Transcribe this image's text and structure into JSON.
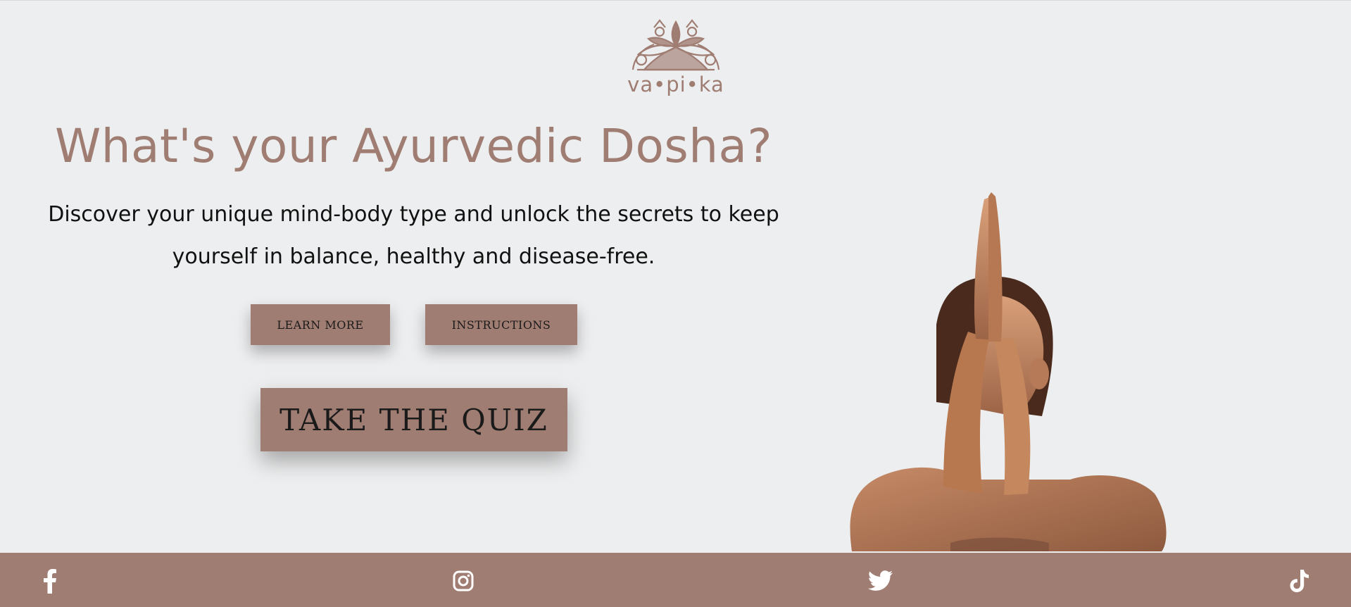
{
  "brand": {
    "name": "va•pi•ka",
    "logo_icon": "mandala-lotus-icon",
    "color": "#a07d72"
  },
  "hero": {
    "title": "What's your Ayurvedic Dosha?",
    "subtitle": "Discover your unique mind-body type and unlock the secrets to keep yourself in balance, healthy and disease-free.",
    "image": "woman-prayer-hands-photo"
  },
  "buttons": {
    "learn_more": "LEARN MORE",
    "instructions": "INSTRUCTIONS",
    "take_quiz": "TAKE THE QUIZ"
  },
  "footer": {
    "social": [
      "facebook-icon",
      "instagram-icon",
      "twitter-icon",
      "tiktok-icon"
    ]
  },
  "colors": {
    "accent": "#a07d72",
    "background": "#edeeef",
    "text": "#111111"
  }
}
